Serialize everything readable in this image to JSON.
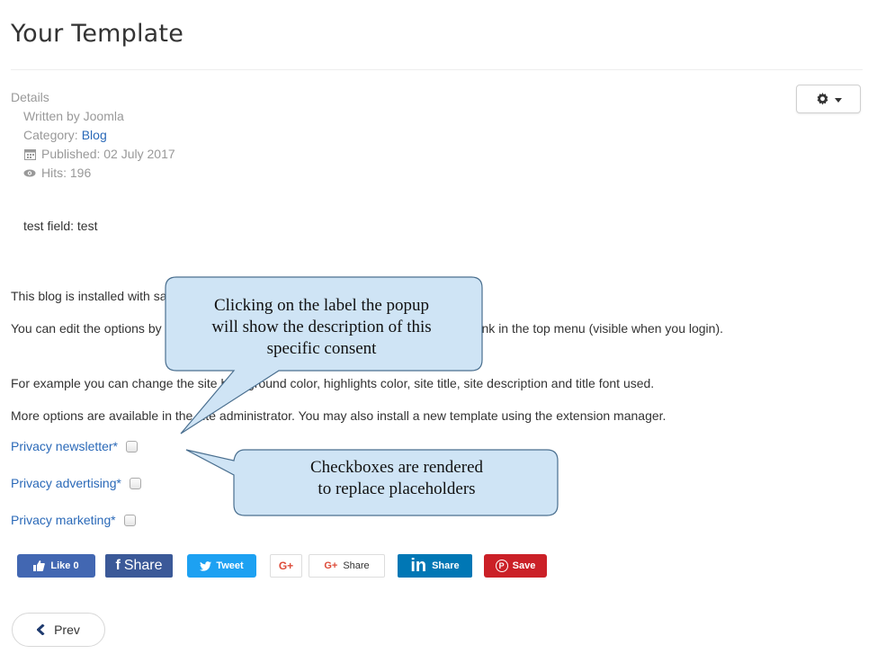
{
  "page": {
    "title": "Your Template"
  },
  "toolbar": {
    "gear_icon": "gear-icon",
    "caret_icon": "chevron-down-icon"
  },
  "details": {
    "heading": "Details",
    "written_by": "Written by Joomla",
    "category_label": "Category:",
    "category_value": "Blog",
    "published": "Published: 02 July 2017",
    "hits": "Hits: 196"
  },
  "custom_field": "test field: test",
  "content": {
    "p1": "This blog is installed with sample data.",
    "p2": "You can edit the options by clicking on the Working on Your Site, Template Settings link in the top menu (visible when you login).",
    "p3": "For example you can change the site background color, highlights color, site title, site description and title font used.",
    "p4": "More options are available in the site administrator. You may also install a new template using the extension manager."
  },
  "privacy": [
    {
      "label": "Privacy newsletter",
      "required": "*"
    },
    {
      "label": "Privacy advertising",
      "required": "*"
    },
    {
      "label": "Privacy marketing",
      "required": "*"
    }
  ],
  "share": {
    "fb_like": "Like 0",
    "fb_share": "Share",
    "tweet": "Tweet",
    "gplus": "G+",
    "gshare": "Share",
    "gshare_icon": "G+",
    "linkedin": "Share",
    "linkedin_icon": "in",
    "pinterest": "Save"
  },
  "nav": {
    "prev": "Prev"
  },
  "callouts": {
    "label_popup": [
      "Clicking on the label the popup",
      "will show the description of this",
      "specific consent"
    ],
    "checkboxes": [
      "Checkboxes are rendered",
      "to replace placeholders"
    ]
  },
  "colors": {
    "link": "#2a69b8",
    "callout_fill": "#cfe4f5",
    "callout_stroke": "#4a6f8f"
  }
}
